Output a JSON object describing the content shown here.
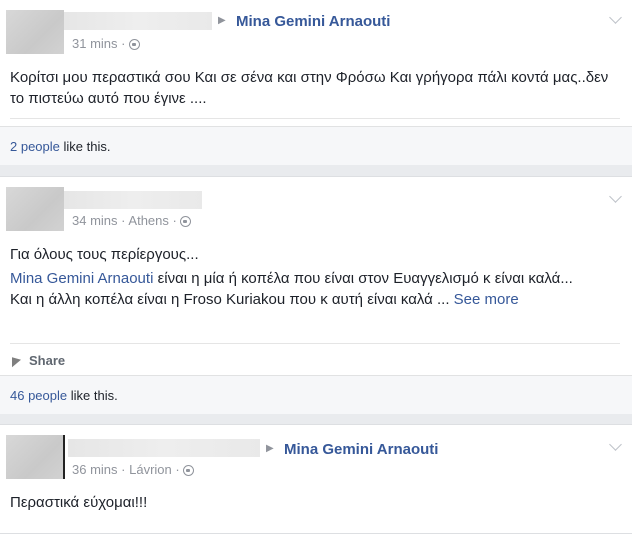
{
  "posts": [
    {
      "target": "Mina Gemini Arnaouti",
      "time": "31 mins",
      "separator": "·",
      "body": "Κορίτσι μου περαστικά σου Και σε σένα και στην Φρόσω Και γρήγορα πάλι κοντά μας..δεν το πιστεύω αυτό που έγινε ....",
      "likes_count": "2 people",
      "likes_suffix": " like this."
    },
    {
      "time": "34 mins",
      "location": "Athens",
      "separator": "·",
      "line1": "Για όλους τους περίεργους...",
      "mention": "Mina Gemini Arnaouti",
      "line2_rest": " είναι η μία ή κοπέλα που είναι στον Ευαγγελισμό κ είναι καλά...",
      "line3": "Και η άλλη κοπέλα είναι η Froso Kuriakou που κ αυτή είναι καλά ...",
      "see_more": " See more",
      "share_label": "Share",
      "likes_count": "46 people",
      "likes_suffix": " like this."
    },
    {
      "target": "Mina Gemini Arnaouti",
      "time": "36 mins",
      "location": "Lávrion",
      "separator": "·",
      "body": "Περαστικά εύχομαι!!!"
    }
  ]
}
